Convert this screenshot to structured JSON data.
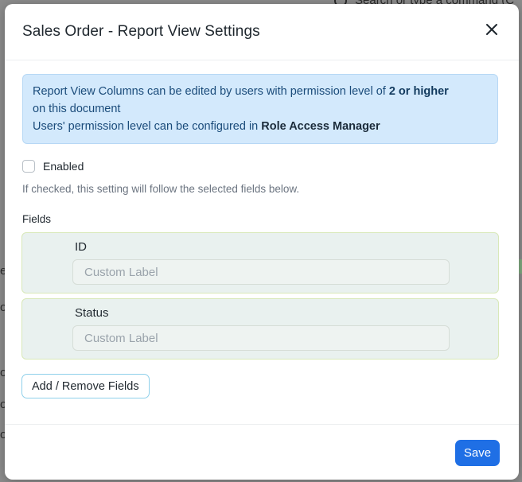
{
  "background": {
    "search_text": "Search or type a command (C"
  },
  "modal": {
    "title": "Sales Order - Report View Settings",
    "close_icon": "close-icon"
  },
  "alert": {
    "line1_prefix": "Report View Columns can be edited by users with permission level of ",
    "line1_bold": "2 or higher",
    "line2": "on this document",
    "line3_prefix": "Users' permission level can be configured in ",
    "line3_bold": "Role Access Manager"
  },
  "enabled": {
    "label": "Enabled",
    "checked": false
  },
  "help_text": "If checked, this setting will follow the selected fields below.",
  "fields": {
    "label": "Fields",
    "items": [
      {
        "name": "ID",
        "placeholder": "Custom Label"
      },
      {
        "name": "Status",
        "placeholder": "Custom Label"
      }
    ]
  },
  "buttons": {
    "add_remove": "Add / Remove Fields",
    "save": "Save"
  },
  "colors": {
    "primary": "#1f6fe5",
    "alert_bg": "#d3e9fc",
    "field_card_bg": "#e9f1ef"
  }
}
